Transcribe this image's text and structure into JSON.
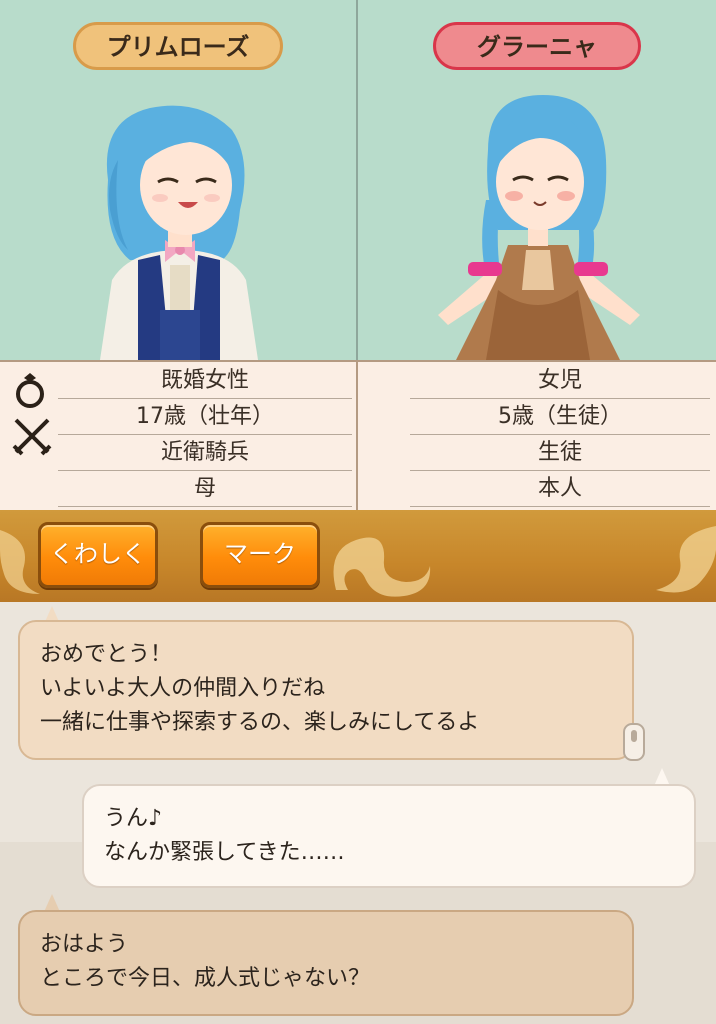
{
  "characters": {
    "left": {
      "name": "プリムローズ",
      "marital_status": "既婚女性",
      "age": "17歳（壮年）",
      "occupation": "近衛騎兵",
      "relation": "母"
    },
    "right": {
      "name": "グラーニャ",
      "marital_status": "女児",
      "age": "5歳（生徒）",
      "occupation": "生徒",
      "relation": "本人"
    }
  },
  "icons": {
    "ring": "ring-icon",
    "swords": "crossed-swords-icon"
  },
  "actions": {
    "details_label": "くわしく",
    "mark_label": "マーク"
  },
  "chat": {
    "messages": [
      {
        "speaker": "left",
        "lines": [
          "おめでとう！",
          "いよいよ大人の仲間入りだね",
          "一緒に仕事や探索するの、楽しみにしてるよ"
        ]
      },
      {
        "speaker": "right",
        "lines": [
          "うん♪",
          "なんか緊張してきた……"
        ]
      },
      {
        "speaker": "left",
        "lines": [
          "おはよう",
          "ところで今日、成人式じゃない？"
        ]
      }
    ]
  },
  "colors": {
    "panel_bg": "#b8dccb",
    "left_badge": "#f0c27b",
    "right_badge": "#ef8a8e",
    "action_bar": "#c7862a",
    "button": "#ff8c0a"
  }
}
